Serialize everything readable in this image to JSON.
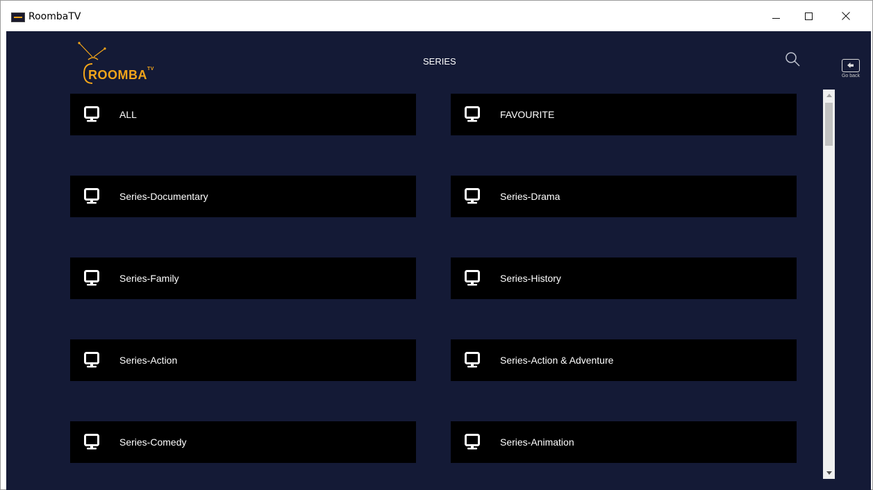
{
  "window": {
    "title": "RoombaTV",
    "controls": {
      "minimize": "minimize-icon",
      "maximize": "maximize-icon",
      "close": "close-icon"
    }
  },
  "header": {
    "logo_text": "ROOMBA",
    "logo_tm": "TV",
    "title": "SERIES",
    "search_icon": "search-icon",
    "go_back_label": "Go back"
  },
  "colors": {
    "background": "#141a36",
    "card": "#000000",
    "accent": "#f2a51a",
    "text": "#ffffff"
  },
  "categories": [
    {
      "label": "ALL",
      "icon": "monitor-icon"
    },
    {
      "label": "FAVOURITE",
      "icon": "monitor-icon"
    },
    {
      "label": "Series-Documentary",
      "icon": "monitor-icon"
    },
    {
      "label": "Series-Drama",
      "icon": "monitor-icon"
    },
    {
      "label": "Series-Family",
      "icon": "monitor-icon"
    },
    {
      "label": "Series-History",
      "icon": "monitor-icon"
    },
    {
      "label": "Series-Action",
      "icon": "monitor-icon"
    },
    {
      "label": "Series-Action & Adventure",
      "icon": "monitor-icon"
    },
    {
      "label": "Series-Comedy",
      "icon": "monitor-icon"
    },
    {
      "label": "Series-Animation",
      "icon": "monitor-icon"
    }
  ]
}
